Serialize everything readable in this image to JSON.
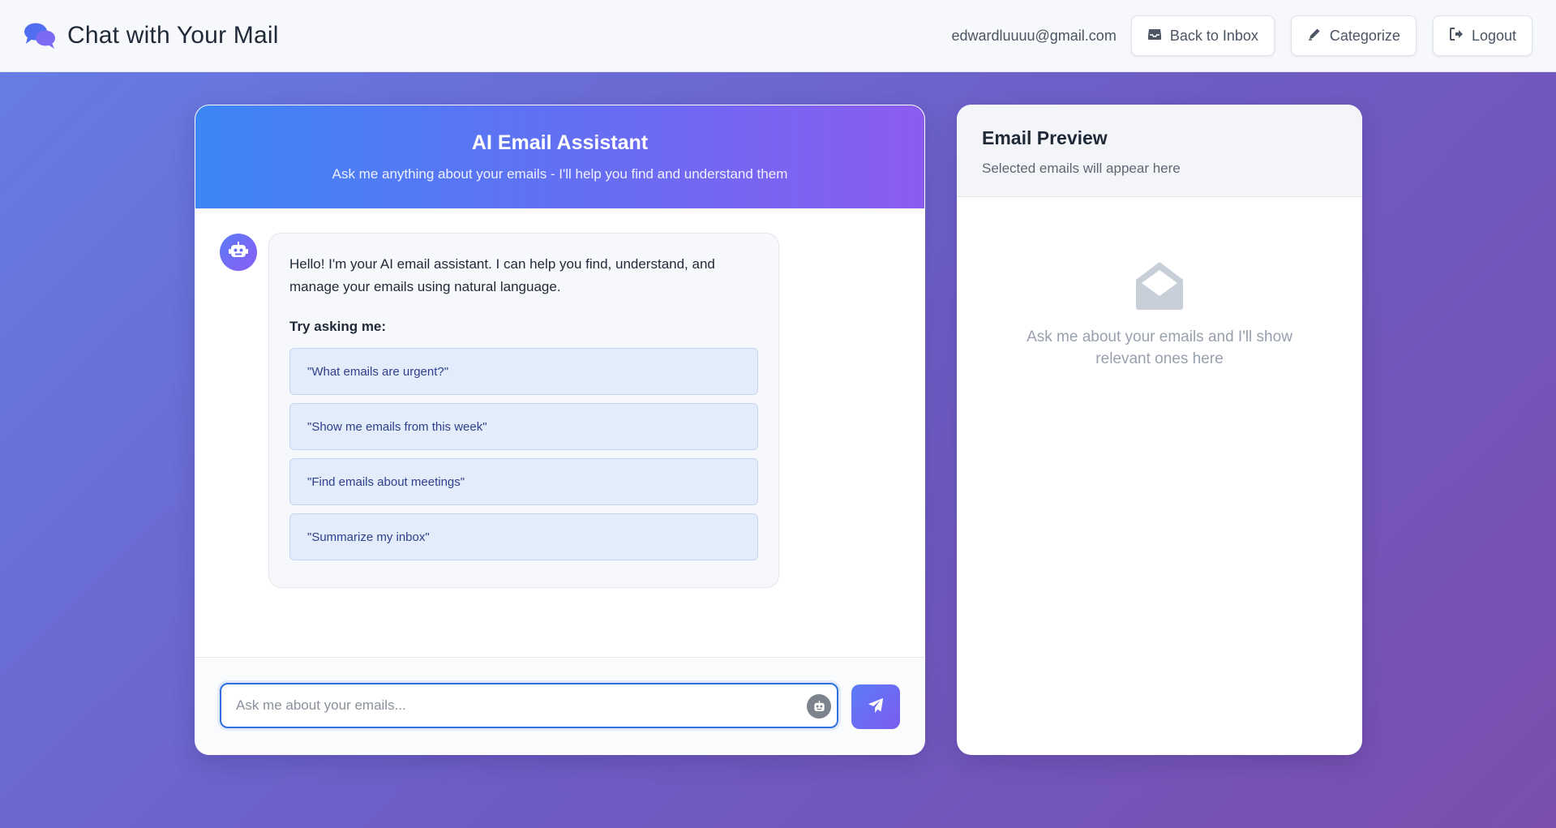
{
  "header": {
    "app_title": "Chat with Your Mail",
    "user_email": "edwardluuuu@gmail.com",
    "buttons": {
      "back_to_inbox": "Back to Inbox",
      "categorize": "Categorize",
      "logout": "Logout"
    }
  },
  "chat": {
    "title": "AI Email Assistant",
    "subtitle": "Ask me anything about your emails - I'll help you find and understand them",
    "welcome_message": "Hello! I'm your AI email assistant. I can help you find, understand, and manage your emails using natural language.",
    "try_label": "Try asking me:",
    "suggestions": [
      "\"What emails are urgent?\"",
      "\"Show me emails from this week\"",
      "\"Find emails about meetings\"",
      "\"Summarize my inbox\""
    ],
    "input": {
      "value": "",
      "placeholder": "Ask me about your emails..."
    }
  },
  "preview": {
    "title": "Email Preview",
    "subtitle": "Selected emails will appear here",
    "empty_text": "Ask me about your emails and I'll show relevant ones here"
  },
  "icons": {
    "brand": "comments-icon",
    "back_to_inbox": "inbox-icon",
    "categorize": "pencil-icon",
    "logout": "logout-icon",
    "assistant": "robot-icon",
    "send": "paper-plane-icon",
    "empty_state": "envelope-open-icon"
  },
  "colors": {
    "accent": "#3d86f6",
    "accent_purple": "#8c5cf0",
    "suggestion_bg": "#e3ecfa",
    "suggestion_text": "#2d3f8f"
  }
}
